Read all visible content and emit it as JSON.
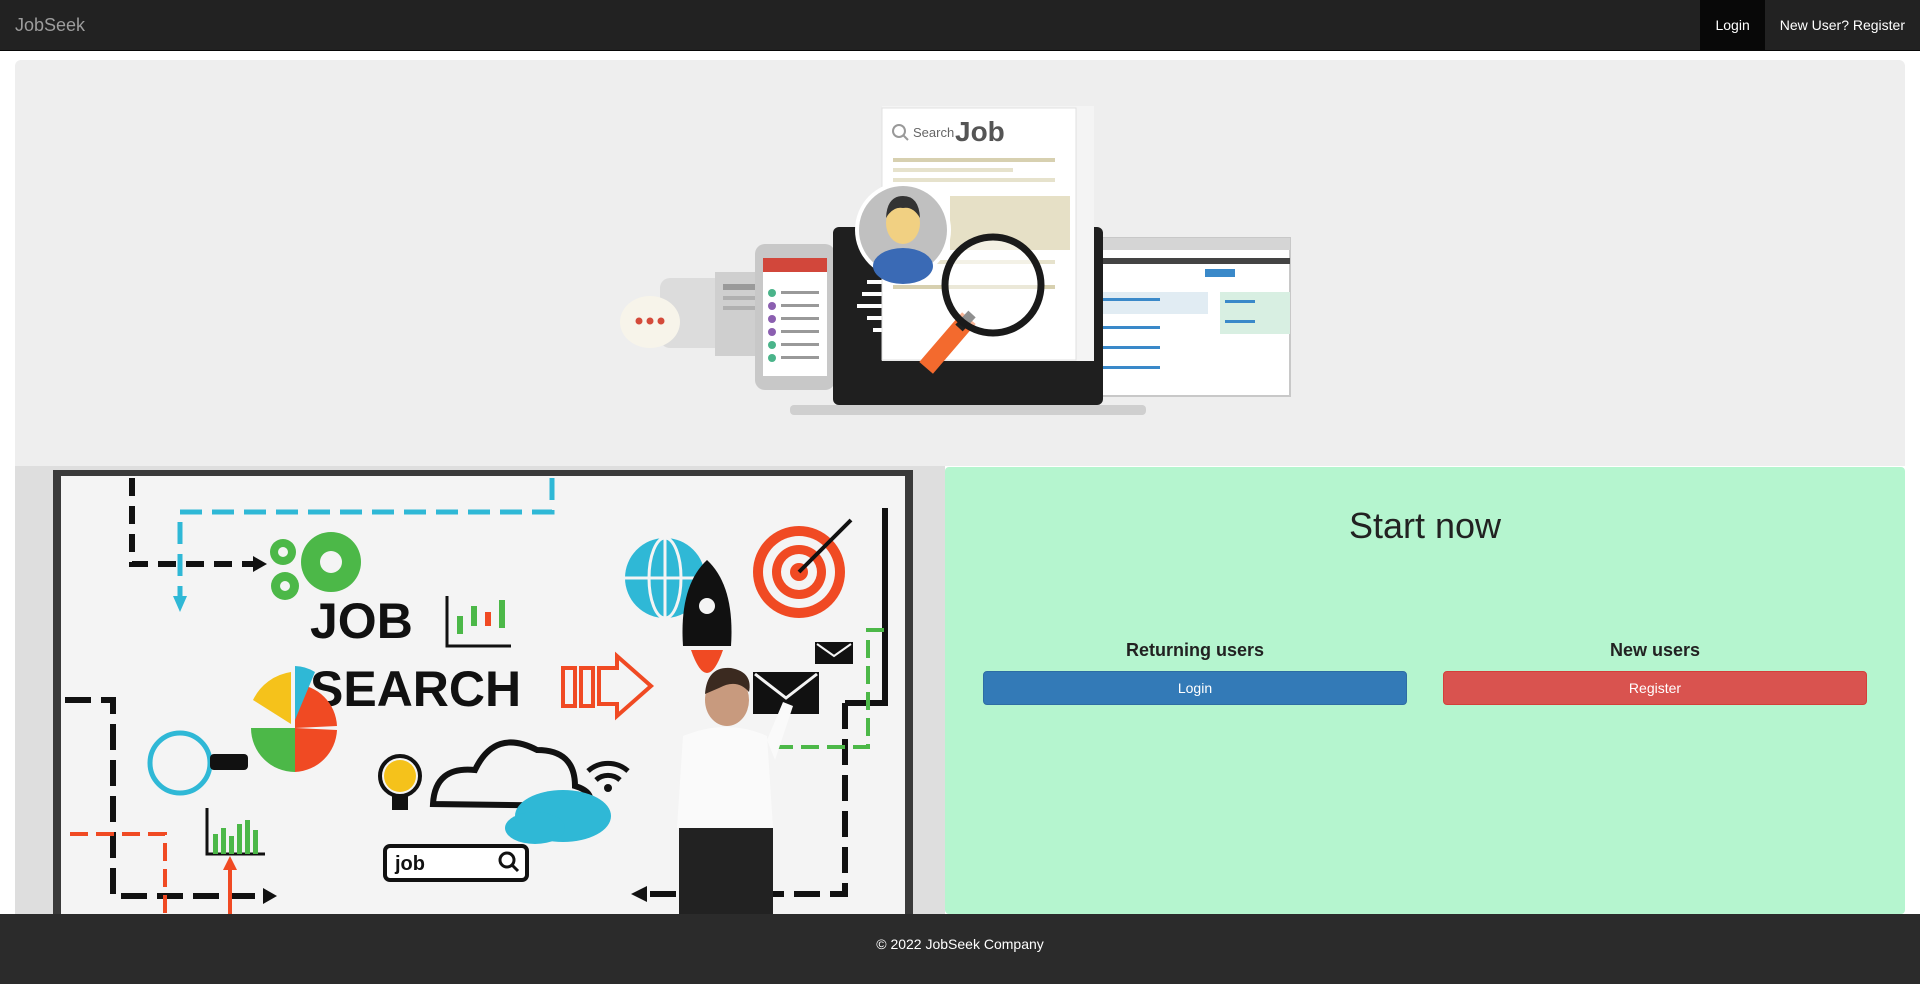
{
  "navbar": {
    "brand": "JobSeek",
    "login_label": "Login",
    "register_label": "New User? Register"
  },
  "hero": {
    "search_word": "Search",
    "job_word": "Job"
  },
  "board": {
    "line1": "JOB",
    "line2": "SEARCH",
    "search_box_text": "job"
  },
  "start": {
    "title": "Start now",
    "returning_heading": "Returning users",
    "returning_button": "Login",
    "new_heading": "New users",
    "new_button": "Register"
  },
  "footer": {
    "text": "© 2022 JobSeek Company"
  },
  "colors": {
    "navbar": "#222222",
    "panel_green": "#b5f5cf",
    "primary": "#337ab7",
    "danger": "#d9534f",
    "footer": "#2b2b2b"
  }
}
